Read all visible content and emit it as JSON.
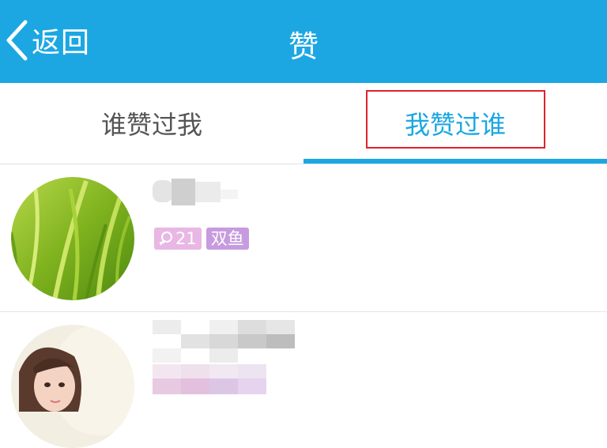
{
  "header": {
    "back_label": "返回",
    "title": "赞",
    "background": "#1ca7e3"
  },
  "tabs": [
    {
      "label": "谁赞过我",
      "selected": false
    },
    {
      "label": "我赞过谁",
      "selected": true
    }
  ],
  "list": {
    "items": [
      {
        "name": "",
        "age": "21",
        "constellation": "双鱼",
        "gender_icon": "female-icon"
      },
      {
        "name": "",
        "age": "",
        "constellation": ""
      }
    ]
  },
  "colors": {
    "accent": "#1ca7e3",
    "highlight_box": "#e0222a",
    "age_badge": "#e9b7e4",
    "sign_badge": "#c79be0"
  }
}
